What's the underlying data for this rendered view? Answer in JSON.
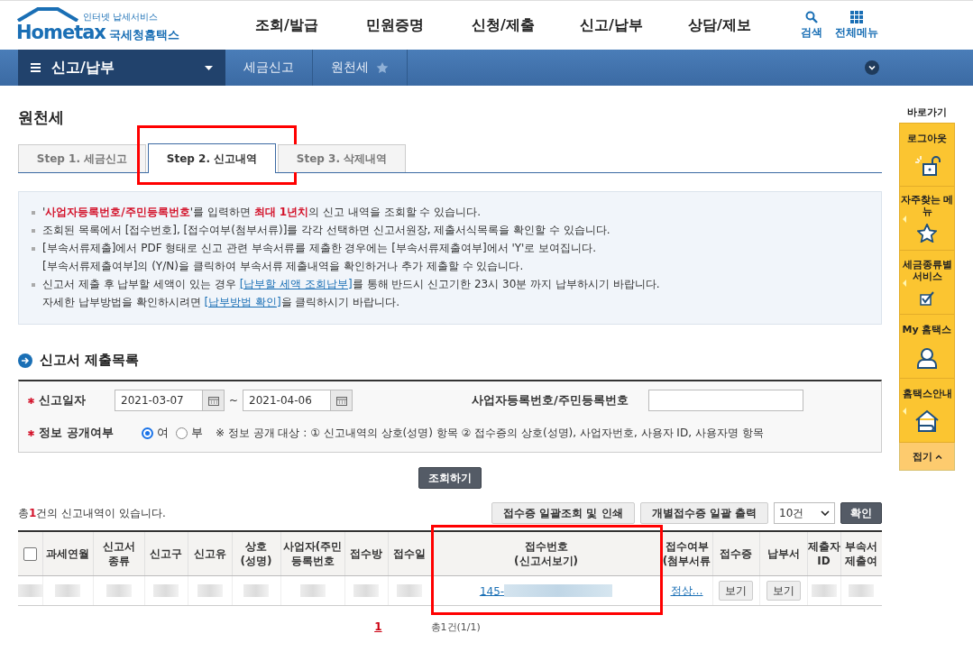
{
  "header": {
    "logo": {
      "tagline": "인터넷 납세서비스",
      "brand": "Hometax",
      "name": "국세청홈택스"
    },
    "menu": [
      "조회/발급",
      "민원증명",
      "신청/제출",
      "신고/납부",
      "상담/제보"
    ],
    "tools": [
      {
        "kind": "search",
        "label": "검색"
      },
      {
        "kind": "grid",
        "label": "전체메뉴"
      }
    ]
  },
  "nav": {
    "menu": "신고/납부",
    "crumbs": [
      "세금신고",
      "원천세"
    ]
  },
  "page_title": "원천세",
  "tabs": [
    {
      "label": "Step 1. 세금신고",
      "selected": false,
      "highlighted": false
    },
    {
      "label": "Step 2. 신고내역",
      "selected": true,
      "highlighted": true
    },
    {
      "label": "Step 3. 삭제내역",
      "selected": false,
      "highlighted": false
    }
  ],
  "notices": [
    {
      "lines": [
        [
          {
            "kind": "text",
            "text": "'**사업자등록번호/주민등록번호**'를 입력하면 **최대 1년치**의 신고 내역을 조회할 수 있습니다."
          }
        ]
      ]
    },
    {
      "lines": [
        [
          {
            "kind": "text",
            "text": "조회된 목록에서 [접수번호], [접수여부(첨부서류)]를 각각 선택하면 신고서원장, 제출서식목록을 확인할 수 있습니다."
          }
        ]
      ]
    },
    {
      "lines": [
        [
          {
            "kind": "text",
            "text": "[부속서류제출]에서 PDF 형태로 신고 관련 부속서류를 제출한 경우에는 [부속서류제출여부]에서 'Y'로 보여집니다."
          }
        ],
        [
          {
            "kind": "text",
            "text": "[부속서류제출여부]의 (Y/N)을 클릭하여 부속서류 제출내역을 확인하거나 추가 제출할 수 있습니다."
          }
        ]
      ]
    },
    {
      "lines": [
        [
          {
            "kind": "text",
            "text": "신고서 제출 후 납부할 세액이 있는 경우 "
          },
          {
            "kind": "link",
            "text": "[납부할 세액 조회납부]"
          },
          {
            "kind": "text",
            "text": "를 통해 반드시 신고기한 23시 30분 까지 납부하시기 바랍니다."
          }
        ],
        [
          {
            "kind": "text",
            "text": "자세한 납부방법을 확인하시려면 "
          },
          {
            "kind": "link",
            "text": "[납부방법 확인]"
          },
          {
            "kind": "text",
            "text": "을 클릭하시기 바랍니다."
          }
        ]
      ]
    }
  ],
  "section_title": "신고서 제출목록",
  "search": {
    "date_required": true,
    "public_required": true,
    "date_label": "신고일자",
    "date_from": "2021-03-07",
    "range_sep": "~",
    "date_to": "2021-04-06",
    "id_label": "사업자등록번호/주민등록번호",
    "public_label": "정보 공개여부",
    "public_options": [
      {
        "label": "여",
        "selected": true
      },
      {
        "label": "부",
        "selected": false
      }
    ],
    "public_note": "※ 정보 공개 대상 : ① 신고내역의 상호(성명) 항목 ② 접수증의 상호(성명), 사업자번호, 사용자 ID, 사용자명 항목",
    "button": "조회하기"
  },
  "result_summary": "총**1**건의 신고내역이 있습니다.",
  "toolbar": {
    "buttons": [
      "접수증 일괄조회 및 인쇄",
      "개별접수증 일괄 출력"
    ],
    "page_size": "10건",
    "confirm": "확인"
  },
  "table": {
    "columns": [
      {
        "kind": "checkbox",
        "checked": false
      },
      {
        "lines": [
          "과세연월"
        ]
      },
      {
        "lines": [
          "신고서",
          "종류"
        ]
      },
      {
        "lines": [
          "신고구"
        ]
      },
      {
        "lines": [
          "신고유"
        ]
      },
      {
        "lines": [
          "상호",
          "(성명)"
        ]
      },
      {
        "lines": [
          "사업자(주민",
          "등록번호"
        ]
      },
      {
        "lines": [
          "접수방"
        ]
      },
      {
        "lines": [
          "접수일"
        ]
      },
      {
        "lines": [
          "접수번호",
          "(신고서보기)"
        ],
        "highlighted": true
      },
      {
        "lines": [
          "접수여부",
          "(첨부서류"
        ]
      },
      {
        "lines": [
          "접수증"
        ]
      },
      {
        "lines": [
          "납부서"
        ]
      },
      {
        "lines": [
          "제출자",
          "ID"
        ]
      },
      {
        "lines": [
          "부속서",
          "제출여"
        ]
      }
    ],
    "rows": [
      {
        "cells": [
          {
            "kind": "redacted"
          },
          {
            "kind": "redacted"
          },
          {
            "kind": "redacted"
          },
          {
            "kind": "redacted"
          },
          {
            "kind": "redacted"
          },
          {
            "kind": "redacted"
          },
          {
            "kind": "redacted"
          },
          {
            "kind": "redacted"
          },
          {
            "kind": "redacted"
          },
          {
            "kind": "link",
            "text": "145-",
            "redacted": true
          },
          {
            "kind": "link",
            "text": "정상…",
            "redacted": false
          },
          {
            "kind": "button",
            "text": "보기"
          },
          {
            "kind": "button",
            "text": "보기"
          },
          {
            "kind": "redacted"
          },
          {
            "kind": "redacted"
          }
        ]
      }
    ]
  },
  "pagination": {
    "pages": [
      {
        "label": "1",
        "selected": true
      }
    ],
    "summary": "총1건(1/1)"
  },
  "sidebar": {
    "title": "바로가기",
    "items": [
      {
        "label": "로그아웃",
        "kind": "logout",
        "pointer": false
      },
      {
        "label": "자주찾는 메뉴",
        "kind": "favorites",
        "pointer": true
      },
      {
        "label": "세금종류별 서비스",
        "kind": "services",
        "pointer": true
      },
      {
        "label": "My 홈택스",
        "kind": "mypage",
        "pointer": false
      },
      {
        "label": "홈택스안내",
        "kind": "guide",
        "pointer": true
      }
    ],
    "collapse": "접기"
  }
}
